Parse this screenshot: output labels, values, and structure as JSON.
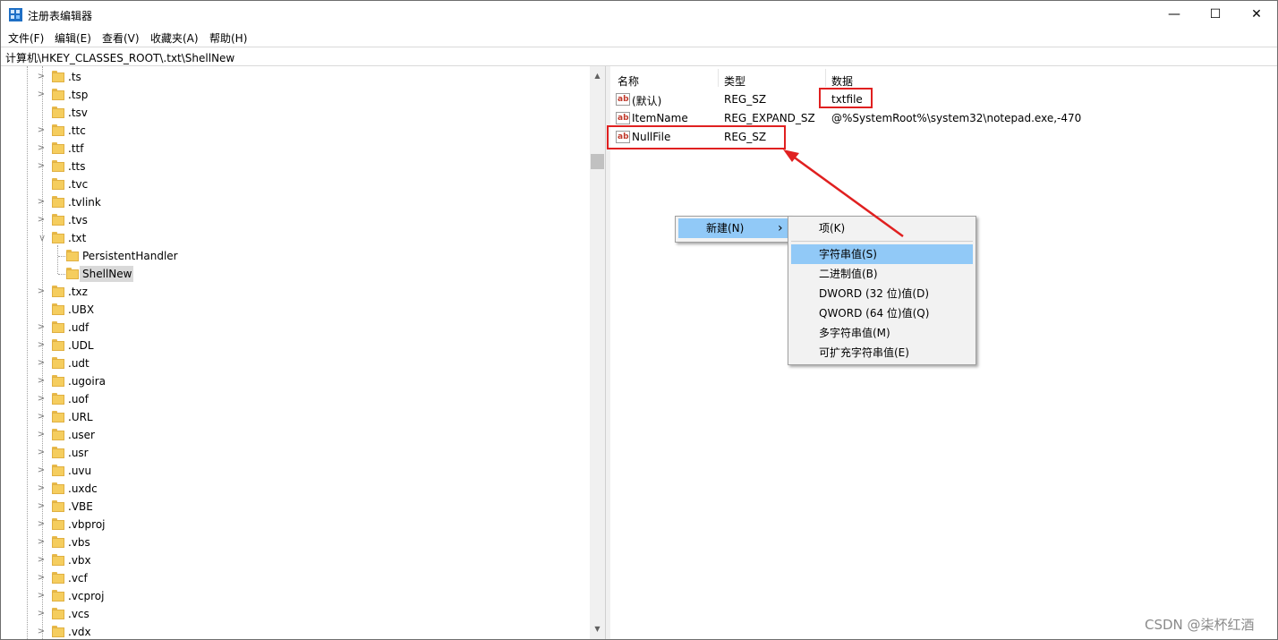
{
  "window": {
    "title": "注册表编辑器",
    "controls": {
      "minimize": "—",
      "maximize": "☐",
      "close": "✕"
    }
  },
  "menubar": {
    "items": [
      "文件(F)",
      "编辑(E)",
      "查看(V)",
      "收藏夹(A)",
      "帮助(H)"
    ]
  },
  "address": {
    "path": "计算机\\HKEY_CLASSES_ROOT\\.txt\\ShellNew"
  },
  "tree": {
    "items": [
      ".ts",
      ".tsp",
      ".tsv",
      ".ttc",
      ".ttf",
      ".tts",
      ".tvc",
      ".tvlink",
      ".tvs",
      ".txt",
      "PersistentHandler",
      "ShellNew",
      ".txz",
      ".UBX",
      ".udf",
      ".UDL",
      ".udt",
      ".ugoira",
      ".uof",
      ".URL",
      ".user",
      ".usr",
      ".uvu",
      ".uxdc",
      ".VBE",
      ".vbproj",
      ".vbs",
      ".vbx",
      ".vcf",
      ".vcproj",
      ".vcs",
      ".vdx"
    ],
    "selected": "ShellNew",
    "expanded": ".txt"
  },
  "list": {
    "columns": [
      "名称",
      "类型",
      "数据"
    ],
    "rows": [
      {
        "name": "(默认)",
        "type": "REG_SZ",
        "data": "txtfile"
      },
      {
        "name": "ItemName",
        "type": "REG_EXPAND_SZ",
        "data": "@%SystemRoot%\\system32\\notepad.exe,-470"
      },
      {
        "name": "NullFile",
        "type": "REG_SZ",
        "data": ""
      }
    ]
  },
  "context_menu": {
    "parent": {
      "label": "新建(N)",
      "arrow": "›"
    },
    "items": [
      "项(K)",
      "字符串值(S)",
      "二进制值(B)",
      "DWORD (32 位)值(D)",
      "QWORD (64 位)值(Q)",
      "多字符串值(M)",
      "可扩充字符串值(E)"
    ],
    "highlighted": "字符串值(S)"
  },
  "colors": {
    "annotation": "#e02020",
    "menu_highlight": "#91c9f7",
    "folder": "#f5cd5e"
  },
  "watermark": "CSDN @柒杯红酒"
}
